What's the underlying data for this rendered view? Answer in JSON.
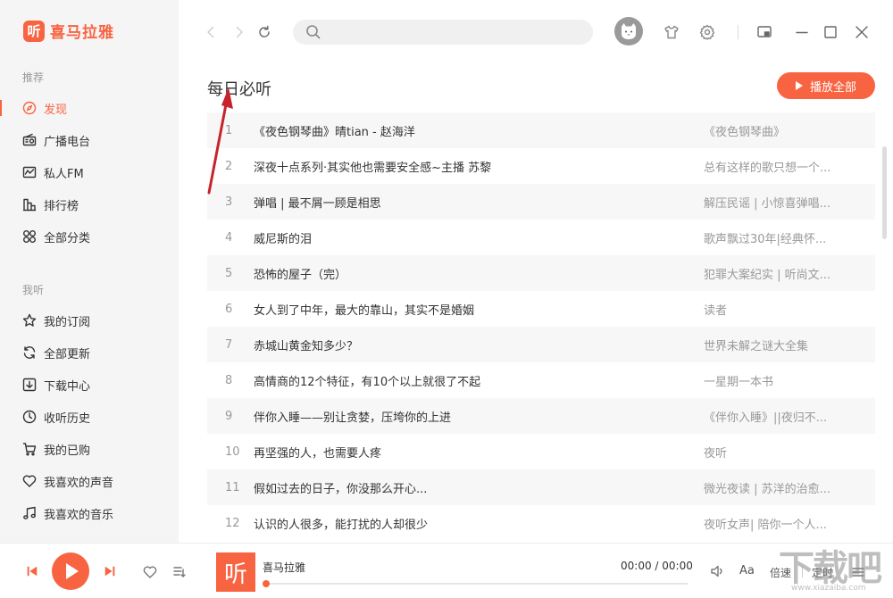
{
  "app": {
    "logo_glyph": "听",
    "name": "喜马拉雅",
    "accent_color": "#f86442"
  },
  "sidebar": {
    "sections": [
      {
        "title": "推荐",
        "items": [
          {
            "label": "发现",
            "icon": "compass-icon",
            "active": true
          },
          {
            "label": "广播电台",
            "icon": "radio-icon"
          },
          {
            "label": "私人FM",
            "icon": "fm-icon"
          },
          {
            "label": "排行榜",
            "icon": "chart-icon"
          },
          {
            "label": "全部分类",
            "icon": "grid-icon"
          }
        ]
      },
      {
        "title": "我听",
        "items": [
          {
            "label": "我的订阅",
            "icon": "star-icon"
          },
          {
            "label": "全部更新",
            "icon": "refresh-icon"
          },
          {
            "label": "下载中心",
            "icon": "download-icon"
          },
          {
            "label": "收听历史",
            "icon": "clock-icon"
          },
          {
            "label": "我的已购",
            "icon": "cart-icon"
          },
          {
            "label": "我喜欢的声音",
            "icon": "heart-icon"
          },
          {
            "label": "我喜欢的音乐",
            "icon": "music-icon"
          }
        ]
      }
    ]
  },
  "topbar": {
    "search_placeholder": "",
    "icons": [
      "back-icon",
      "forward-icon",
      "refresh-icon",
      "search-icon",
      "avatar",
      "skin-icon",
      "settings-icon",
      "mini-mode-icon",
      "minimize-icon",
      "maximize-icon",
      "close-icon"
    ]
  },
  "main": {
    "title": "每日必听",
    "play_all_label": "播放全部",
    "tracks": [
      {
        "num": "1",
        "title": "《夜色钢琴曲》晴tian - 赵海洋",
        "album": "《夜色钢琴曲》"
      },
      {
        "num": "2",
        "title": "深夜十点系列·其实他也需要安全感~主播 苏黎",
        "album": "总有这样的歌只想一个..."
      },
      {
        "num": "3",
        "title": "弹唱 | 最不屑一顾是相思",
        "album": "解压民谣 | 小惊喜弹唱..."
      },
      {
        "num": "4",
        "title": "威尼斯的泪",
        "album": "歌声飘过30年|经典怀..."
      },
      {
        "num": "5",
        "title": "恐怖的屋子（完）",
        "album": "犯罪大案纪实 | 听尚文..."
      },
      {
        "num": "6",
        "title": "女人到了中年，最大的靠山，其实不是婚姻",
        "album": "读者"
      },
      {
        "num": "7",
        "title": "赤城山黄金知多少？",
        "album": "世界未解之谜大全集"
      },
      {
        "num": "8",
        "title": "高情商的12个特征，有10个以上就很了不起",
        "album": "一星期一本书"
      },
      {
        "num": "9",
        "title": "伴你入睡——别让贪婪，压垮你的上进",
        "album": "《伴你入睡》||夜归不..."
      },
      {
        "num": "10",
        "title": "再坚强的人，也需要人疼",
        "album": "夜听"
      },
      {
        "num": "11",
        "title": "假如过去的日子，你没那么开心...",
        "album": "微光夜读 | 苏洋的治愈..."
      },
      {
        "num": "12",
        "title": "认识的人很多，能打扰的人却很少",
        "album": "夜听女声| 陪你一个人..."
      }
    ]
  },
  "player": {
    "now_playing": "喜马拉雅",
    "cover_glyph": "听",
    "time": "00:00 / 00:00",
    "progress": 0,
    "speed_label": "倍速",
    "timer_label": "定时",
    "font_label": "Aa"
  },
  "watermark": {
    "text": "下载吧",
    "url": "www.xiazaiba.com"
  }
}
